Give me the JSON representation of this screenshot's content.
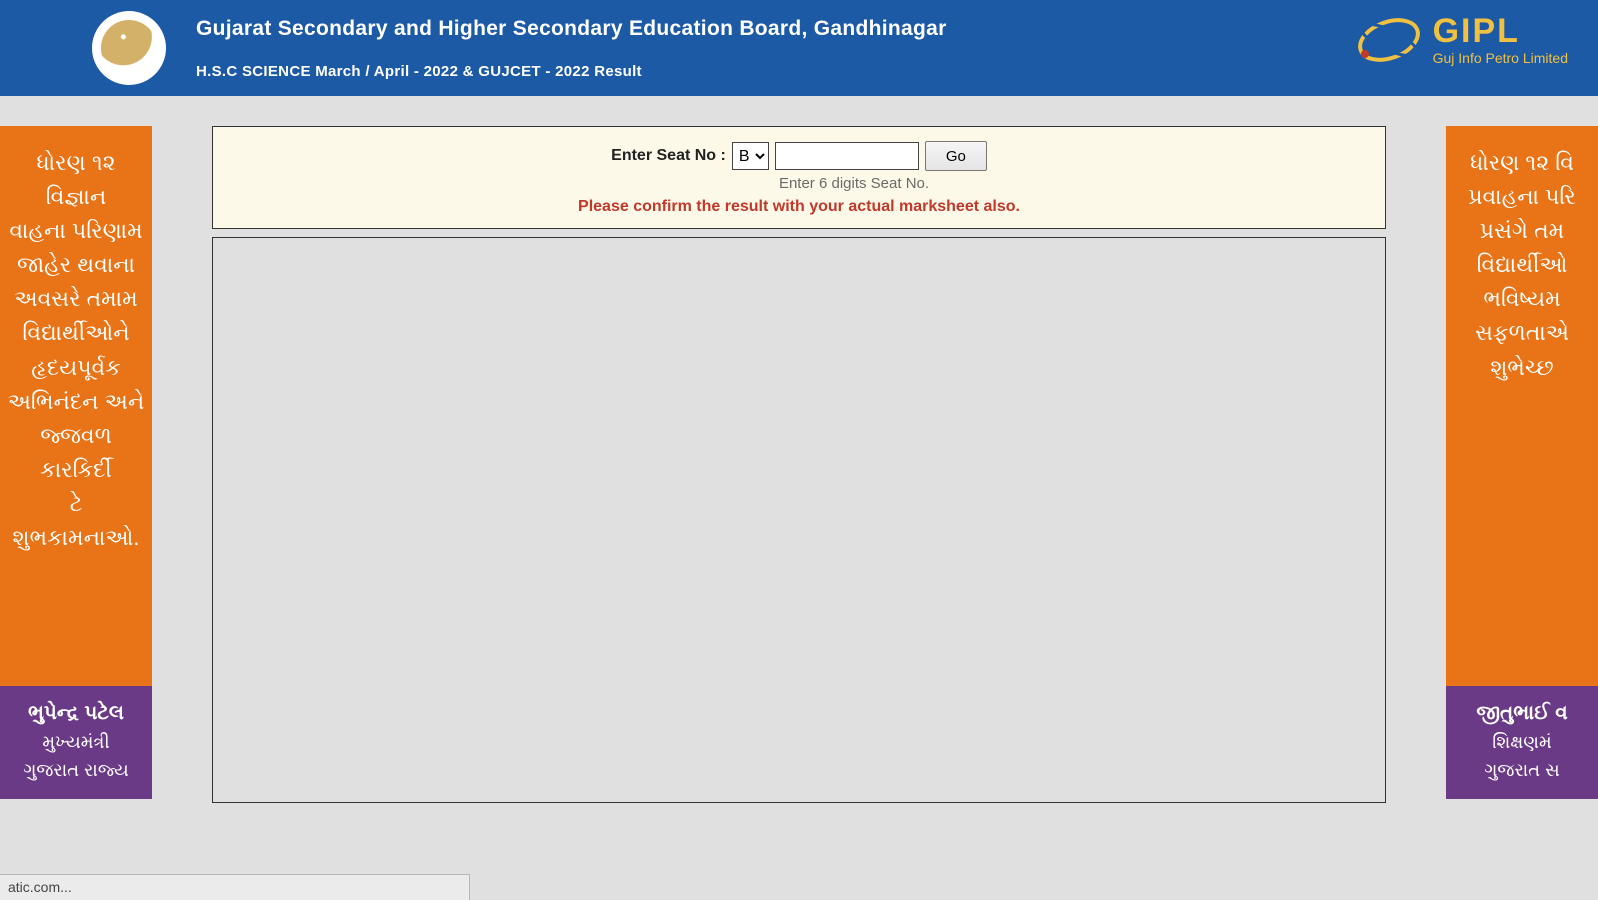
{
  "header": {
    "title": "Gujarat Secondary and Higher Secondary Education Board, Gandhinagar",
    "subtitle": "H.S.C SCIENCE March / April - 2022 & GUJCET - 2022 Result"
  },
  "brand": {
    "acronym": "GIPL",
    "full": "Guj Info Petro Limited"
  },
  "form": {
    "label": "Enter Seat No :",
    "prefix_selected": "B",
    "seat_value": "",
    "go_label": "Go",
    "hint": "Enter 6 digits Seat No.",
    "warning": "Please confirm the result with your actual marksheet also."
  },
  "left_banner": {
    "message": "ધોરણ ૧૨ વિજ્ઞાન\nવાહના પરિણામ\nજાહેર થવાના\nઅવસરે તમામ\nવિદ્યાર્થીઓને\nહૃદયપૂર્વક\nઅભિનંદન અને\nજ્જવળ કારકિર્દી\nટે શુભકામનાઓ.",
    "signature_name": "ભુપેન્દ્ર પટેલ",
    "signature_role": "મુખ્યમંત્રી\nગુજરાત રાજ્ય"
  },
  "right_banner": {
    "message": "ધોરણ ૧૨ વિ\nપ્રવાહના પરિ\nપ્રસંગે તમ\nવિદ્યાર્થીઓ\nભવિષ્યમ\nસફળતાએ\nશુભેચ્છ",
    "signature_name": "જીતુભાઈ વ",
    "signature_role": "શિક્ષણમં\nગુજરાત સ"
  },
  "status": {
    "text": "atic.com..."
  }
}
